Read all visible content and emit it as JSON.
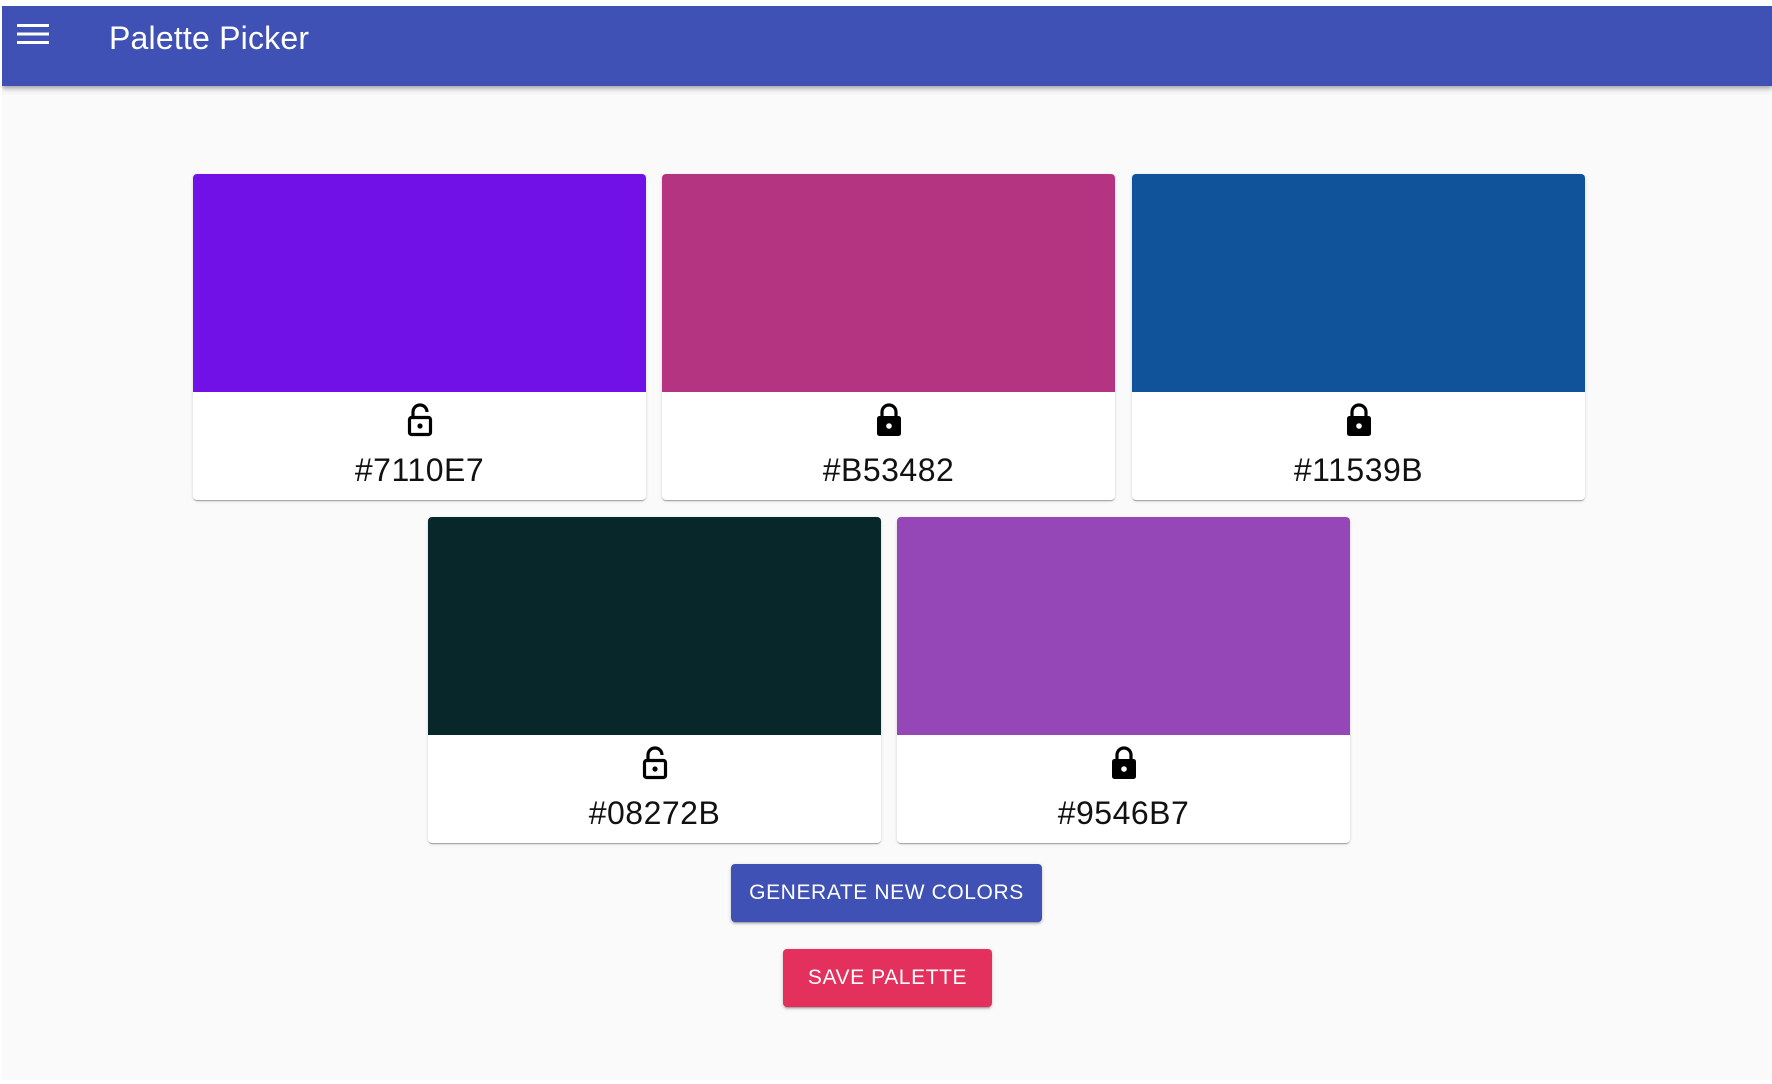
{
  "app": {
    "title": "Palette Picker",
    "bar_color": "#3f51b5"
  },
  "palette": [
    {
      "hex": "#7110E7",
      "locked": false
    },
    {
      "hex": "#B53482",
      "locked": true
    },
    {
      "hex": "#11539B",
      "locked": true
    },
    {
      "hex": "#08272B",
      "locked": false
    },
    {
      "hex": "#9546B7",
      "locked": true
    }
  ],
  "actions": {
    "generate_label": "GENERATE NEW COLORS",
    "generate_color": "#3f51b5",
    "save_label": "SAVE PALETTE",
    "save_color": "#e3305c"
  },
  "icons": {
    "menu": "menu-icon",
    "locked": "lock-closed-icon",
    "unlocked": "lock-open-icon"
  }
}
